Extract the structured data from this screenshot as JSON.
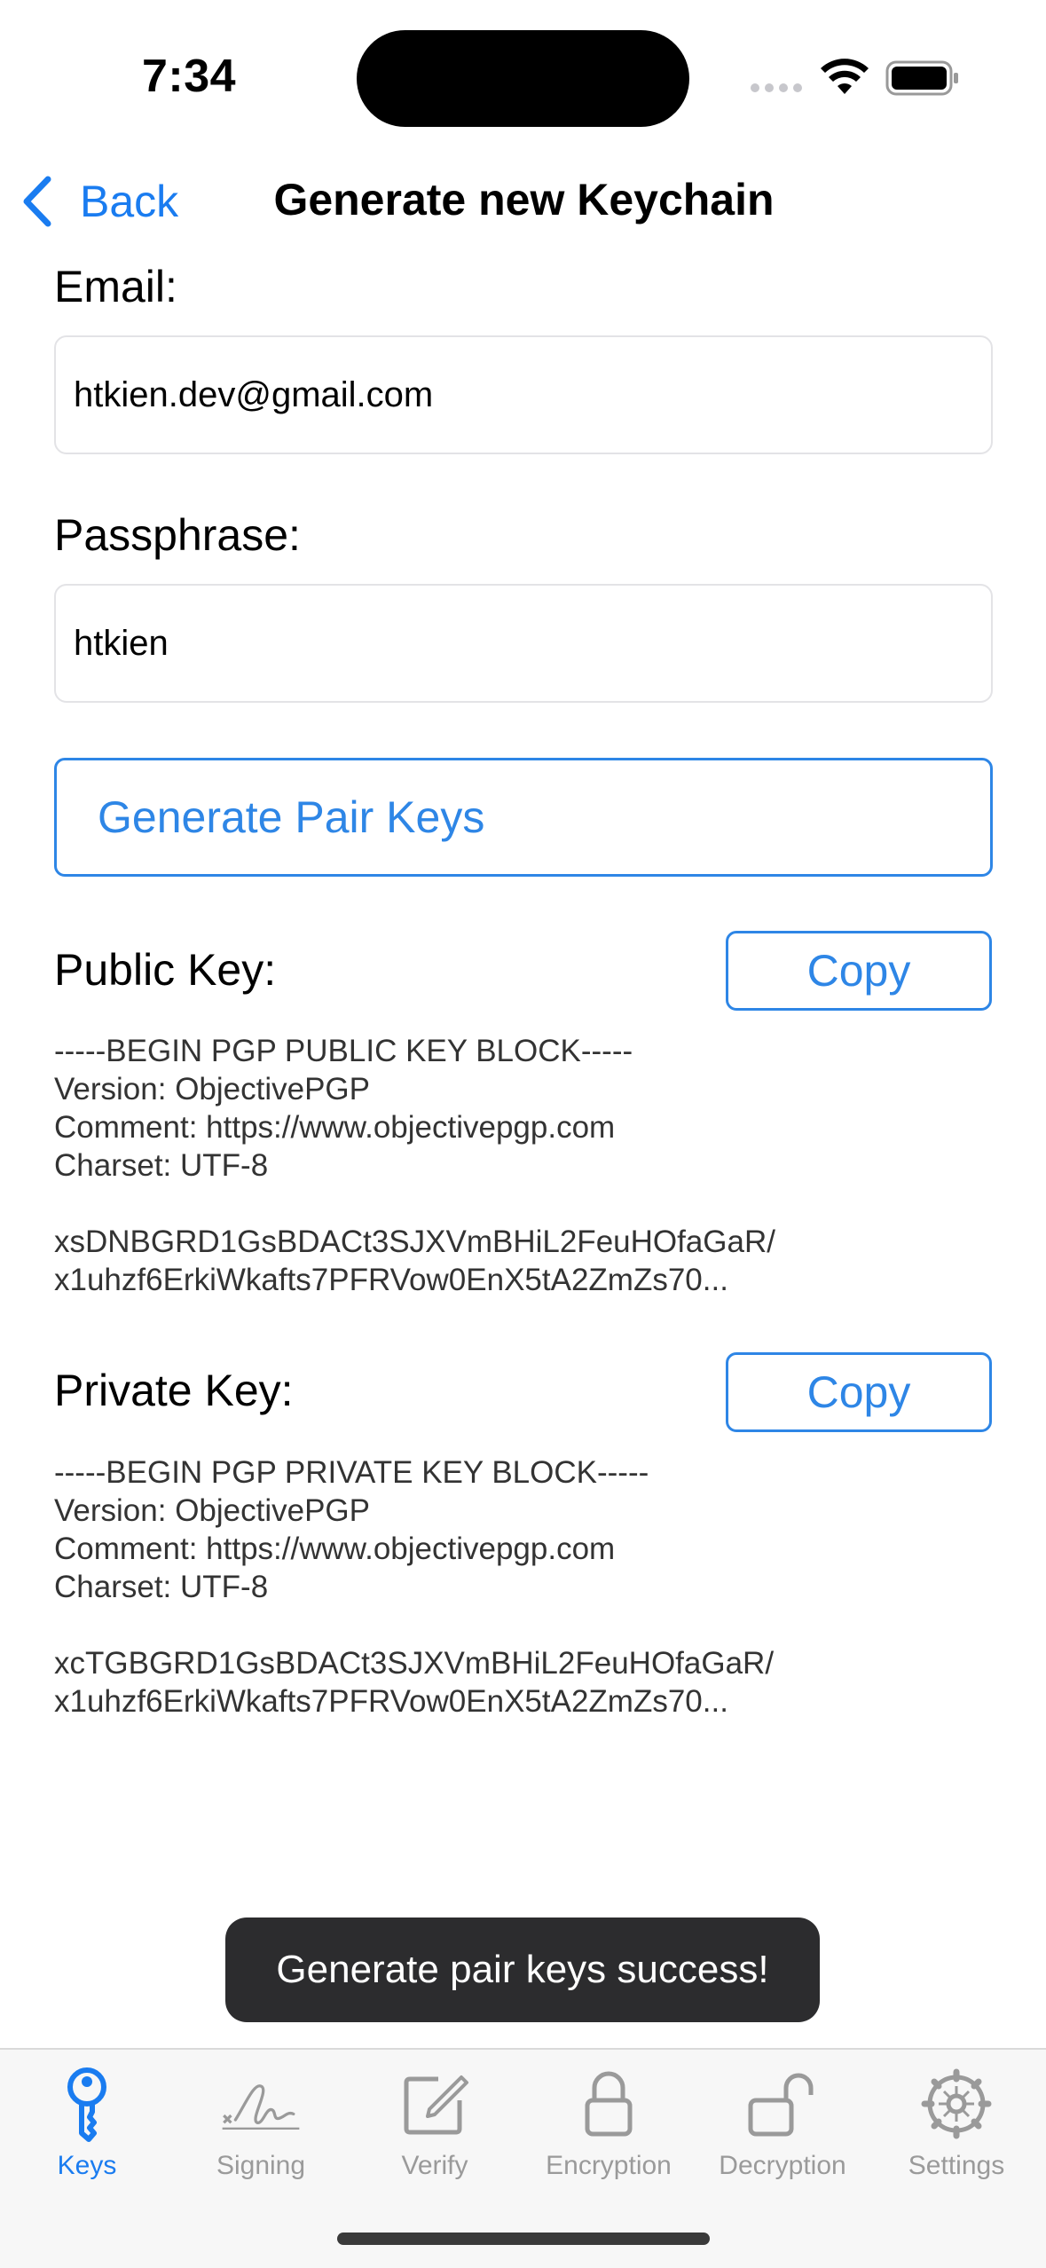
{
  "status": {
    "time": "7:34"
  },
  "nav": {
    "back_label": "Back",
    "title": "Generate new Keychain"
  },
  "form": {
    "email_label": "Email:",
    "email_value": "htkien.dev@gmail.com",
    "passphrase_label": "Passphrase:",
    "passphrase_value": "htkien",
    "generate_button": "Generate Pair Keys"
  },
  "public_key": {
    "label": "Public Key:",
    "copy_label": "Copy",
    "text": "-----BEGIN PGP PUBLIC KEY BLOCK-----\nVersion: ObjectivePGP\nComment: https://www.objectivepgp.com\nCharset: UTF-8\n\nxsDNBGRD1GsBDACt3SJXVmBHiL2FeuHOfaGaR/\nx1uhzf6ErkiWkafts7PFRVow0EnX5tA2ZmZs70..."
  },
  "private_key": {
    "label": "Private Key:",
    "copy_label": "Copy",
    "text": "-----BEGIN PGP PRIVATE KEY BLOCK-----\nVersion: ObjectivePGP\nComment: https://www.objectivepgp.com\nCharset: UTF-8\n\nxcTGBGRD1GsBDACt3SJXVmBHiL2FeuHOfaGaR/\nx1uhzf6ErkiWkafts7PFRVow0EnX5tA2ZmZs70..."
  },
  "toast": "Generate pair keys success!",
  "tabs": [
    {
      "label": "Keys",
      "icon": "key-icon",
      "active": true
    },
    {
      "label": "Signing",
      "icon": "signature-icon",
      "active": false
    },
    {
      "label": "Verify",
      "icon": "compose-icon",
      "active": false
    },
    {
      "label": "Encryption",
      "icon": "lock-icon",
      "active": false
    },
    {
      "label": "Decryption",
      "icon": "unlock-icon",
      "active": false
    },
    {
      "label": "Settings",
      "icon": "gear-icon",
      "active": false
    }
  ],
  "colors": {
    "accent": "#1a7cf0",
    "button_border": "#2e86e6",
    "tab_inactive": "#9a9a9a",
    "toast_bg": "#2c2c2e"
  }
}
